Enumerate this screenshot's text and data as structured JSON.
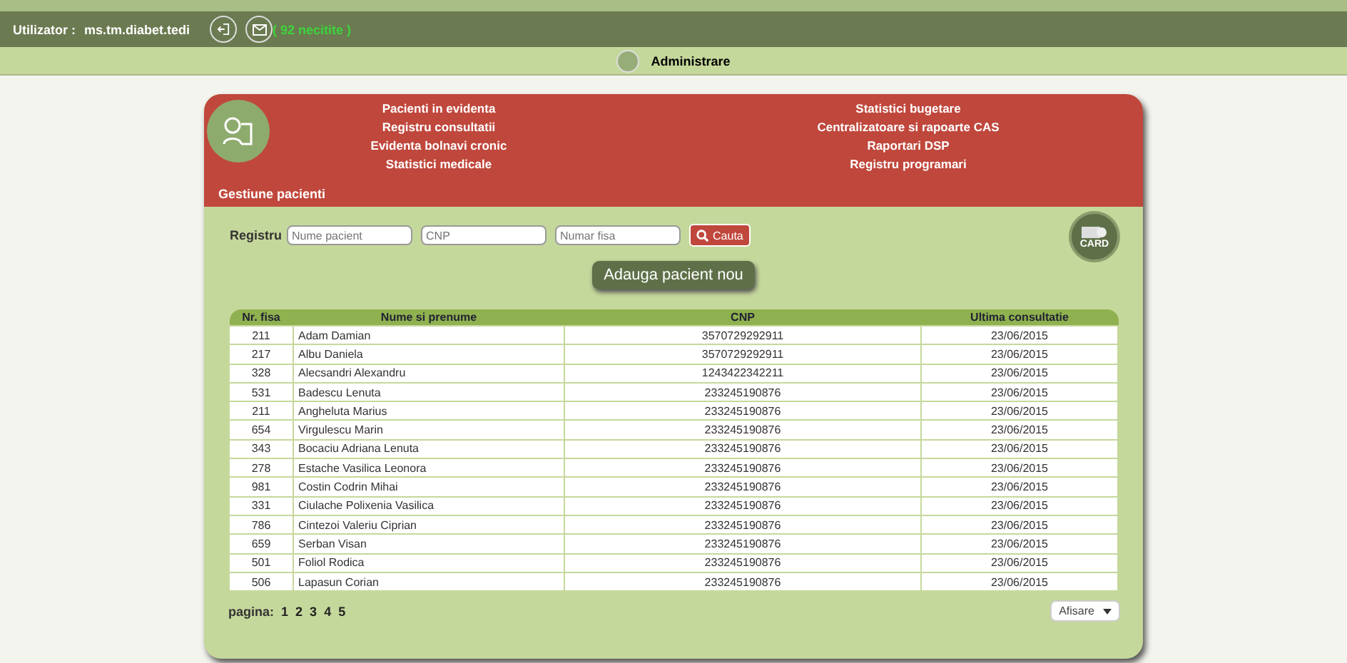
{
  "top_bar": {
    "user_label": "Utilizator :",
    "username": "ms.tm.diabet.tedi",
    "messages": "( 92 necitite )"
  },
  "nav_bar": {
    "item": "Administrare"
  },
  "header": {
    "section": "Gestiune pacienti",
    "menu_left": [
      "Pacienti in evidenta",
      "Registru consultatii",
      "Evidenta bolnavi cronic",
      "Statistici medicale"
    ],
    "menu_right": [
      "Statistici bugetare",
      "Centralizatoare si rapoarte CAS",
      "Raportari DSP",
      "Registru programari"
    ]
  },
  "search": {
    "label": "Registru",
    "fields": [
      {
        "placeholder": "Nume pacient"
      },
      {
        "placeholder": "CNP"
      },
      {
        "placeholder": "Numar fisa"
      }
    ],
    "button": "Cauta",
    "card_label": "CARD"
  },
  "add_button": "Adauga pacient nou",
  "table": {
    "columns": [
      "Nr. fisa",
      "Nume si prenume",
      "CNP",
      "Ultima consultatie"
    ],
    "rows": [
      [
        "211",
        "Adam Damian",
        "3570729292911",
        "23/06/2015"
      ],
      [
        "217",
        "Albu Daniela",
        "3570729292911",
        "23/06/2015"
      ],
      [
        "328",
        "Alecsandri Alexandru",
        "1243422342211",
        "23/06/2015"
      ],
      [
        "531",
        "Badescu Lenuta",
        "233245190876",
        "23/06/2015"
      ],
      [
        "211",
        "Angheluta Marius",
        "233245190876",
        "23/06/2015"
      ],
      [
        "654",
        "Virgulescu Marin",
        "233245190876",
        "23/06/2015"
      ],
      [
        "343",
        "Bocaciu Adriana Lenuta",
        "233245190876",
        "23/06/2015"
      ],
      [
        "278",
        "Estache Vasilica Leonora",
        "233245190876",
        "23/06/2015"
      ],
      [
        "981",
        "Costin Codrin Mihai",
        "233245190876",
        "23/06/2015"
      ],
      [
        "331",
        "Ciulache Polixenia Vasilica",
        "233245190876",
        "23/06/2015"
      ],
      [
        "786",
        "Cintezoi Valeriu Ciprian",
        "233245190876",
        "23/06/2015"
      ],
      [
        "659",
        "Serban Visan",
        "233245190876",
        "23/06/2015"
      ],
      [
        "501",
        "Foliol Rodica",
        "233245190876",
        "23/06/2015"
      ],
      [
        "506",
        "Lapasun Corian",
        "233245190876",
        "23/06/2015"
      ]
    ]
  },
  "pagination": {
    "label": "pagina:",
    "pages": [
      "1",
      "2",
      "3",
      "4",
      "5"
    ],
    "display_select": "Afisare"
  }
}
